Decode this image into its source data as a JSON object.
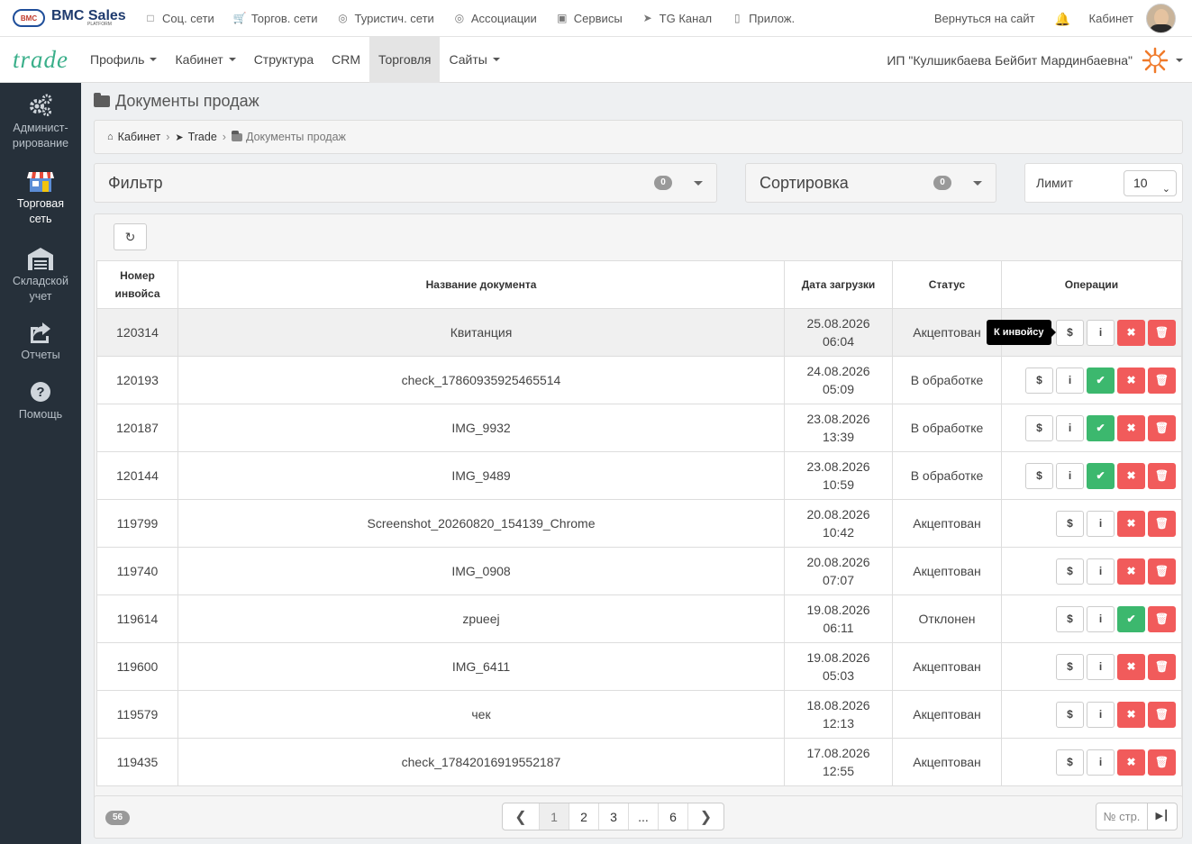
{
  "topbar": {
    "logo_text": "BMC Sales",
    "logo_sub": "PLATFORM",
    "links": [
      {
        "label": "Соц. сети",
        "icon": "chat-icon"
      },
      {
        "label": "Торгов. сети",
        "icon": "cart-icon"
      },
      {
        "label": "Туристич. сети",
        "icon": "globe-icon"
      },
      {
        "label": "Ассоциации",
        "icon": "basketball-icon"
      },
      {
        "label": "Сервисы",
        "icon": "briefcase-icon"
      },
      {
        "label": "TG Канал",
        "icon": "send-icon"
      },
      {
        "label": "Прилож.",
        "icon": "mobile-icon"
      }
    ],
    "back_to_site": "Вернуться на сайт",
    "cabinet": "Кабинет"
  },
  "navbar": {
    "brand": "trade",
    "items": [
      {
        "label": "Профиль",
        "dropdown": true
      },
      {
        "label": "Кабинет",
        "dropdown": true
      },
      {
        "label": "Структура",
        "dropdown": false
      },
      {
        "label": "CRM",
        "dropdown": false
      },
      {
        "label": "Торговля",
        "dropdown": false,
        "active": true
      },
      {
        "label": "Сайты",
        "dropdown": true
      }
    ],
    "org_name": "ИП \"Кулшикбаева Бейбит Мардинбаевна\""
  },
  "sidebar": {
    "items": [
      {
        "label": "Админист-\nрирование",
        "icon": "gears-icon"
      },
      {
        "label": "Торговая\nсеть",
        "icon": "store-icon",
        "active": true
      },
      {
        "label": "Складской\nучет",
        "icon": "warehouse-icon"
      },
      {
        "label": "Отчеты",
        "icon": "share-icon"
      },
      {
        "label": "Помощь",
        "icon": "question-icon"
      }
    ]
  },
  "page": {
    "title": "Документы продаж",
    "breadcrumb": [
      "Кабинет",
      "Trade",
      "Документы продаж"
    ],
    "filter_label": "Фильтр",
    "filter_count": "0",
    "sort_label": "Сортировка",
    "sort_count": "0",
    "limit_label": "Лимит",
    "limit_value": "10"
  },
  "table": {
    "headers": [
      "Номер инвойса",
      "Название документа",
      "Дата загрузки",
      "Статус",
      "Операции"
    ],
    "tooltip": "К инвойсу",
    "rows": [
      {
        "invoice": "120314",
        "name": "Квитанция",
        "date": "25.08.2026",
        "time": "06:04",
        "status": "Акцептован",
        "ops": [
          "invoice",
          "info",
          "reject",
          "delete"
        ]
      },
      {
        "invoice": "120193",
        "name": "check_17860935925465514",
        "date": "24.08.2026",
        "time": "05:09",
        "status": "В обработке",
        "ops": [
          "invoice",
          "info",
          "accept",
          "reject",
          "delete"
        ]
      },
      {
        "invoice": "120187",
        "name": "IMG_9932",
        "date": "23.08.2026",
        "time": "13:39",
        "status": "В обработке",
        "ops": [
          "invoice",
          "info",
          "accept",
          "reject",
          "delete"
        ]
      },
      {
        "invoice": "120144",
        "name": "IMG_9489",
        "date": "23.08.2026",
        "time": "10:59",
        "status": "В обработке",
        "ops": [
          "invoice",
          "info",
          "accept",
          "reject",
          "delete"
        ]
      },
      {
        "invoice": "119799",
        "name": "Screenshot_20260820_154139_Chrome",
        "date": "20.08.2026",
        "time": "10:42",
        "status": "Акцептован",
        "ops": [
          "invoice",
          "info",
          "reject",
          "delete"
        ]
      },
      {
        "invoice": "119740",
        "name": "IMG_0908",
        "date": "20.08.2026",
        "time": "07:07",
        "status": "Акцептован",
        "ops": [
          "invoice",
          "info",
          "reject",
          "delete"
        ]
      },
      {
        "invoice": "119614",
        "name": "zpueej",
        "date": "19.08.2026",
        "time": "06:11",
        "status": "Отклонен",
        "ops": [
          "invoice",
          "info",
          "accept",
          "delete"
        ]
      },
      {
        "invoice": "119600",
        "name": "IMG_6411",
        "date": "19.08.2026",
        "time": "05:03",
        "status": "Акцептован",
        "ops": [
          "invoice",
          "info",
          "reject",
          "delete"
        ]
      },
      {
        "invoice": "119579",
        "name": "чек",
        "date": "18.08.2026",
        "time": "12:13",
        "status": "Акцептован",
        "ops": [
          "invoice",
          "info",
          "reject",
          "delete"
        ]
      },
      {
        "invoice": "119435",
        "name": "check_17842016919552187",
        "date": "17.08.2026",
        "time": "12:55",
        "status": "Акцептован",
        "ops": [
          "invoice",
          "info",
          "reject",
          "delete"
        ]
      }
    ]
  },
  "pagination": {
    "total": "56",
    "pages": [
      "1",
      "2",
      "3",
      "...",
      "6"
    ],
    "current": "1",
    "goto_placeholder": "№ стр."
  },
  "colors": {
    "sidebar_bg": "#26303a",
    "brand": "#3aaf8a",
    "accept": "#3cb86e",
    "reject": "#f15b5b"
  }
}
